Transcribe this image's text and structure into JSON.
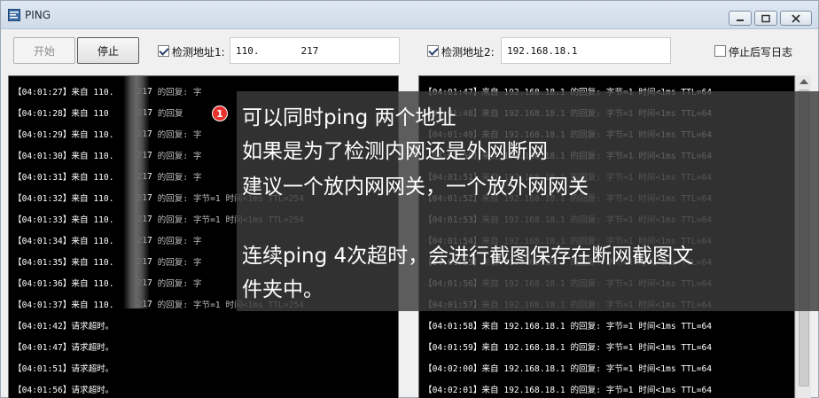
{
  "window": {
    "title": "PING",
    "icon": "app-icon"
  },
  "toolbar": {
    "start_label": "开始",
    "stop_label": "停止",
    "addr1": {
      "label": "检测地址1:",
      "checked": true,
      "value_prefix": "110.",
      "value_suffix": "217"
    },
    "addr2": {
      "label": "检测地址2:",
      "checked": true,
      "value": "192.168.18.1"
    },
    "stop_log": {
      "label": "停止后写日志",
      "checked": false
    }
  },
  "console1": {
    "lines": [
      {
        "ts": "【04:01:27】",
        "text": "来自 110.",
        "mid": "217",
        "tail": "的回复: 字"
      },
      {
        "ts": "【04:01:28】",
        "text": "来自 110",
        "mid": "217",
        "tail": "的回复"
      },
      {
        "ts": "【04:01:29】",
        "text": "来自 110.",
        "mid": "217",
        "tail": "的回复: 字"
      },
      {
        "ts": "【04:01:30】",
        "text": "来自 110.",
        "mid": "217",
        "tail": "的回复: 字"
      },
      {
        "ts": "【04:01:31】",
        "text": "来自 110.",
        "mid": "217",
        "tail": "的回复: 字"
      },
      {
        "ts": "【04:01:32】",
        "text": "来自 110.",
        "mid": "217",
        "tail": "的回复: 字节=1 时间<1ms TTL=254"
      },
      {
        "ts": "【04:01:33】",
        "text": "来自 110.",
        "mid": "217",
        "tail": "的回复: 字节=1 时间<1ms TTL=254"
      },
      {
        "ts": "【04:01:34】",
        "text": "来自 110.",
        "mid": "217",
        "tail": "的回复: 字"
      },
      {
        "ts": "【04:01:35】",
        "text": "来自 110.",
        "mid": "217",
        "tail": "的回复: 字"
      },
      {
        "ts": "【04:01:36】",
        "text": "来自 110.",
        "mid": "217",
        "tail": "的回复: 字"
      },
      {
        "ts": "【04:01:37】",
        "text": "来自 110.",
        "mid": "217",
        "tail": "的回复: 字节=1 时间<1ms TTL=254"
      },
      {
        "ts": "【04:01:42】",
        "text": "请求超时。",
        "mid": "",
        "tail": ""
      },
      {
        "ts": "【04:01:47】",
        "text": "请求超时。",
        "mid": "",
        "tail": ""
      },
      {
        "ts": "【04:01:51】",
        "text": "请求超时。",
        "mid": "",
        "tail": ""
      },
      {
        "ts": "【04:01:56】",
        "text": "请求超时。",
        "mid": "",
        "tail": ""
      }
    ]
  },
  "console2": {
    "lines": [
      {
        "ts": "【04:01:47】",
        "text": "来自 192.168.18.1 的回复: 字节=1 时间<1ms TTL=64"
      },
      {
        "ts": "【04:01:48】",
        "text": "来自 192.168.18.1 的回复: 字节=1 时间<1ms TTL=64"
      },
      {
        "ts": "【04:01:49】",
        "text": "来自 192.168.18.1 的回复: 字节=1 时间<1ms TTL=64"
      },
      {
        "ts": "【04:01:50】",
        "text": "来自 192.168.18.1 的回复: 字节=1 时间<1ms TTL=64"
      },
      {
        "ts": "【04:01:51】",
        "text": "来自 192.168.18.1 的回复: 字节=1 时间<1ms TTL=64"
      },
      {
        "ts": "【04:01:52】",
        "text": "来自 192.168.18.1 的回复: 字节=1 时间<1ms TTL=64"
      },
      {
        "ts": "【04:01:53】",
        "text": "来自 192.168.18.1 的回复: 字节=1 时间<1ms TTL=64"
      },
      {
        "ts": "【04:01:54】",
        "text": "来自 192.168.18.1 的回复: 字节=1 时间<1ms TTL=64"
      },
      {
        "ts": "【04:01:55】",
        "text": "来自 192.168.18.1 的回复: 字节=1 时间<1ms TTL=64"
      },
      {
        "ts": "【04:01:56】",
        "text": "来自 192.168.18.1 的回复: 字节=1 时间<1ms TTL=64"
      },
      {
        "ts": "【04:01:57】",
        "text": "来自 192.168.18.1 的回复: 字节=1 时间<1ms TTL=64"
      },
      {
        "ts": "【04:01:58】",
        "text": "来自 192.168.18.1 的回复: 字节=1 时间<1ms TTL=64"
      },
      {
        "ts": "【04:01:59】",
        "text": "来自 192.168.18.1 的回复: 字节=1 时间<1ms TTL=64"
      },
      {
        "ts": "【04:02:00】",
        "text": "来自 192.168.18.1 的回复: 字节=1 时间<1ms TTL=64"
      },
      {
        "ts": "【04:02:01】",
        "text": "来自 192.168.18.1 的回复: 字节=1 时间<1ms TTL=64"
      }
    ]
  },
  "annotation": {
    "badge": "1",
    "lines": [
      "可以同时ping 两个地址",
      "如果是为了检测内网还是外网断网",
      "建议一个放内网网关，一个放外网网关",
      "连续ping 4次超时，会进行截图保存在断网截图文",
      "件夹中。"
    ]
  },
  "colors": {
    "console_bg": "#000000",
    "overlay_bg": "#3c3c3c",
    "badge": "#e8322e"
  }
}
